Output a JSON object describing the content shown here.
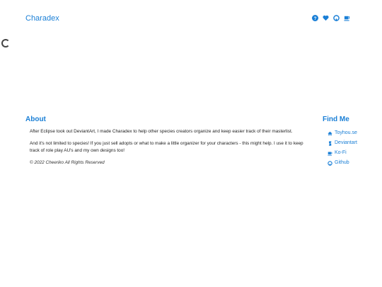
{
  "navbar": {
    "brand": "Charadex",
    "icons": [
      "help-icon",
      "heart-icon",
      "github-icon",
      "coffee-icon"
    ]
  },
  "about": {
    "title": "About",
    "paragraphs": [
      "After Eclipse took out DeviantArt, I made Charadex to help other species creators organize and keep easier track of their masterlist.",
      "And it's not limited to species! If you just sell adopts or what to make a little organizer for your characters - this might help. I use it to keep track of role play AU's and my own designs too!"
    ],
    "copyright": "© 2022 Cheeriko All Rights Reserved"
  },
  "findme": {
    "title": "Find Me",
    "links": [
      {
        "label": "Toyhou.se",
        "icon": "house-icon"
      },
      {
        "label": "Deviantart",
        "icon": "deviantart-icon"
      },
      {
        "label": "Ko-Fi",
        "icon": "coffee-icon"
      },
      {
        "label": "Github",
        "icon": "github-icon"
      }
    ]
  },
  "colors": {
    "accent": "#1a7fd6",
    "text": "#222222"
  }
}
